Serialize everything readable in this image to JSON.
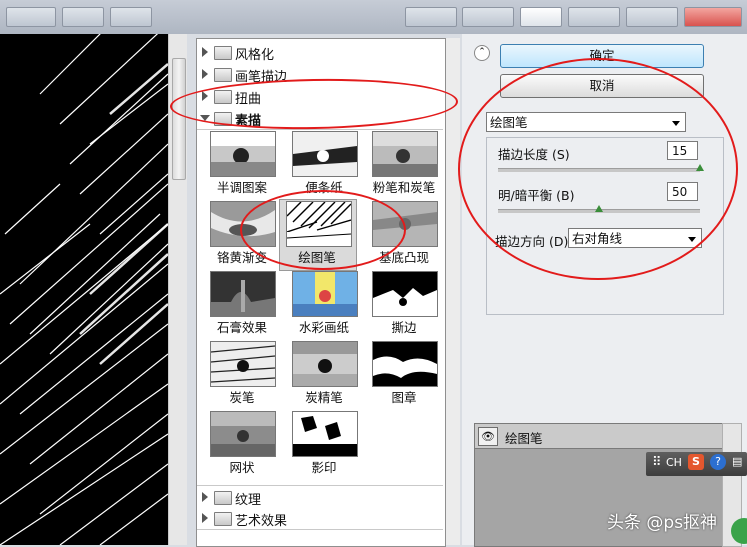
{
  "filters": {
    "categories": [
      {
        "label": "风格化",
        "expanded": false
      },
      {
        "label": "画笔描边",
        "expanded": false
      },
      {
        "label": "扭曲",
        "expanded": false
      },
      {
        "label": "素描",
        "expanded": true
      },
      {
        "label": "纹理",
        "expanded": false
      },
      {
        "label": "艺术效果",
        "expanded": false
      }
    ],
    "sketch_thumbnails": [
      "半调图案",
      "便条纸",
      "粉笔和炭笔",
      "铬黄渐变",
      "绘图笔",
      "基底凸现",
      "石膏效果",
      "水彩画纸",
      "撕边",
      "炭笔",
      "炭精笔",
      "图章",
      "网状",
      "影印"
    ],
    "selected": "绘图笔"
  },
  "panel": {
    "ok_label": "确定",
    "cancel_label": "取消",
    "filter_select": "绘图笔",
    "params": [
      {
        "label": "描边长度 (S)",
        "value": "15",
        "fraction": 1.0
      },
      {
        "label": "明/暗平衡 (B)",
        "value": "50",
        "fraction": 0.5
      }
    ],
    "direction_label": "描边方向 (D):",
    "direction_value": "右对角线"
  },
  "layers": {
    "row_label": "绘图笔"
  },
  "ime": {
    "lang": "CH"
  },
  "watermark": "头条 @ps抠神",
  "colors": {
    "annotation": "#e21b1b",
    "primary_button": "#bee6fd"
  }
}
